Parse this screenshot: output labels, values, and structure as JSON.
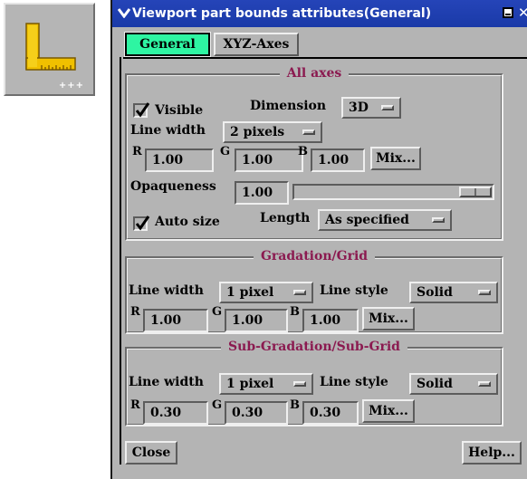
{
  "window": {
    "title": "Viewport part bounds attributes(General)",
    "close_glyph": "✕",
    "minimize_glyph": "▭"
  },
  "tabs": [
    {
      "label": "General",
      "active": true
    },
    {
      "label": "XYZ-Axes",
      "active": false
    }
  ],
  "all_axes": {
    "title": "All axes",
    "visible_label": "Visible",
    "visible_checked": true,
    "dimension_label": "Dimension",
    "dimension_value": "3D",
    "line_width_label": "Line width",
    "line_width_value": "2 pixels",
    "r_label": "R",
    "r_value": "1.00",
    "g_label": "G",
    "g_value": "1.00",
    "b_label": "B",
    "b_value": "1.00",
    "mix_label": "Mix...",
    "opaqueness_label": "Opaqueness",
    "opaqueness_value": "1.00",
    "opaqueness_slider_fraction": 1.0,
    "auto_size_label": "Auto size",
    "auto_size_checked": true,
    "length_label": "Length",
    "length_value": "As specified"
  },
  "gradation_grid": {
    "title": "Gradation/Grid",
    "line_width_label": "Line width",
    "line_width_value": "1 pixel",
    "line_style_label": "Line style",
    "line_style_value": "Solid",
    "r_label": "R",
    "r_value": "1.00",
    "g_label": "G",
    "g_value": "1.00",
    "b_label": "B",
    "b_value": "1.00",
    "mix_label": "Mix..."
  },
  "sub_gradation_grid": {
    "title": "Sub-Gradation/Sub-Grid",
    "line_width_label": "Line width",
    "line_width_value": "1 pixel",
    "line_style_label": "Line style",
    "line_style_value": "Solid",
    "r_label": "R",
    "r_value": "0.30",
    "g_label": "G",
    "g_value": "0.30",
    "b_label": "B",
    "b_value": "0.30",
    "mix_label": "Mix..."
  },
  "footer": {
    "close_label": "Close",
    "help_label": "Help..."
  },
  "tool_icon": {
    "icon": "ruler-icon",
    "badge": "+++"
  },
  "colors": {
    "panel": "#b4b4b4",
    "titlebar": "#1a3aa8",
    "active_tab": "#2ef5a2",
    "frame_title": "#8b1a50",
    "ruler": "#f0c000"
  }
}
